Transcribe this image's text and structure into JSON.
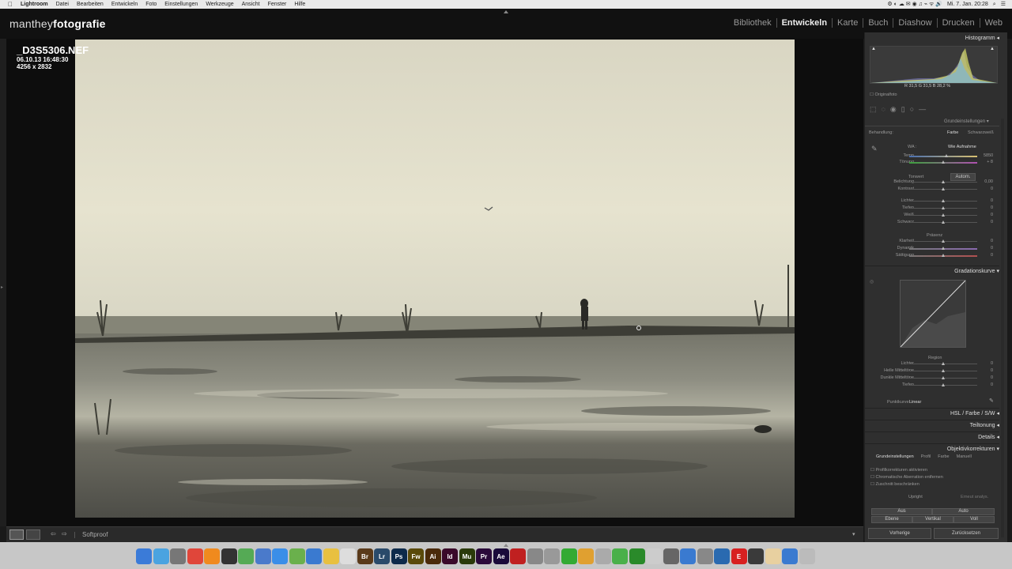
{
  "menubar": {
    "app": "Lightroom",
    "items": [
      "Datei",
      "Bearbeiten",
      "Entwickeln",
      "Foto",
      "Einstellungen",
      "Werkzeuge",
      "Ansicht",
      "Fenster",
      "Hilfe"
    ],
    "clock": "Mi. 7. Jan. 20:28"
  },
  "header": {
    "logo_light": "manthey",
    "logo_bold": "fotografie",
    "modules": [
      "Bibliothek",
      "Entwickeln",
      "Karte",
      "Buch",
      "Diashow",
      "Drucken",
      "Web"
    ],
    "active_module": "Entwickeln"
  },
  "photo_info": {
    "filename": "_D3S5306.NEF",
    "datetime": "06.10.13 16:48:30",
    "dimensions": "4256 x 2832"
  },
  "toolbar": {
    "softproof": "Softproof"
  },
  "right_panel": {
    "histogram_title": "Histogramm",
    "histogram_readout": "R  31,5  G  31,5  B  28,2 %",
    "original_photo": "Originalfoto",
    "grundeinstellungen": "Grundeinstellungen",
    "behandlung": "Behandlung:",
    "farbe": "Farbe",
    "schwarzweiss": "Schwarzweiß",
    "wa_label": "WA :",
    "wa_value": "Wie Aufnahme",
    "temp": {
      "label": "Temp",
      "value": "5850"
    },
    "toenung": {
      "label": "Tönung",
      "value": "+ 8"
    },
    "tonwert": "Tonwert",
    "autom": "Autom.",
    "belichtung": {
      "label": "Belichtung",
      "value": "0,00"
    },
    "kontrast": {
      "label": "Kontrast",
      "value": "0"
    },
    "lichter": {
      "label": "Lichter",
      "value": "0"
    },
    "tiefen": {
      "label": "Tiefen",
      "value": "0"
    },
    "weiss": {
      "label": "Weiß",
      "value": "0"
    },
    "schwarz": {
      "label": "Schwarz",
      "value": "0"
    },
    "praesenz": "Präsenz",
    "klarheit": {
      "label": "Klarheit",
      "value": "0"
    },
    "dynamik": {
      "label": "Dynamik",
      "value": "0"
    },
    "saettigung": {
      "label": "Sättigung",
      "value": "0"
    },
    "gradationskurve": "Gradationskurve",
    "regler": "Region",
    "k_lichter": {
      "label": "Lichter",
      "value": "0"
    },
    "k_helle": {
      "label": "Helle Mitteltöne",
      "value": "0"
    },
    "k_dunkle": {
      "label": "Dunkle Mitteltöne",
      "value": "0"
    },
    "k_tiefen": {
      "label": "Tiefen",
      "value": "0"
    },
    "punktkurve_label": "Punktkurve :",
    "punktkurve_value": "Linear",
    "hsl": "HSL",
    "hsl_farbe": "Farbe",
    "hsl_sw": "S/W",
    "teiltonung": "Teiltonung",
    "details": "Details",
    "objektiv": "Objektivkorrekturen",
    "obj_tabs": [
      "Grundeinstellungen",
      "Profil",
      "Farbe",
      "Manuell"
    ],
    "profil_korr": "Profilkorrekturen aktivieren",
    "chrom_aberr": "Chromatische Aberration entfernen",
    "zuschneiden": "Zuschnitt beschränken",
    "upright": "Upright",
    "erneut": "Erneut analys.",
    "aus": "Aus",
    "auto": "Auto",
    "ebene": "Ebene",
    "vertikal": "Vertikal",
    "voll": "Voll",
    "vorherige": "Vorherige",
    "zuruecksetzen": "Zurücksetzen"
  },
  "dock": {
    "apps": [
      "Finder",
      "Safari",
      "Rocket",
      "iTunes",
      "Squared",
      "Terminal",
      "Migrator",
      "Directory",
      "Safari2",
      "Maps",
      "Info",
      "Notes",
      "Calendar",
      "Bridge",
      "Lr",
      "Ps",
      "Fw",
      "Ai",
      "Id",
      "Mu",
      "Pr",
      "Ae",
      "Acrobat",
      "Pencil",
      "Pen",
      "Evernote",
      "Pages",
      "Preview",
      "Messages",
      "FaceTime",
      "Discs",
      "Sys",
      "Tool",
      "Draw",
      "Chart",
      "E",
      "Activity",
      "Mail",
      "Info2",
      "Trash"
    ]
  }
}
